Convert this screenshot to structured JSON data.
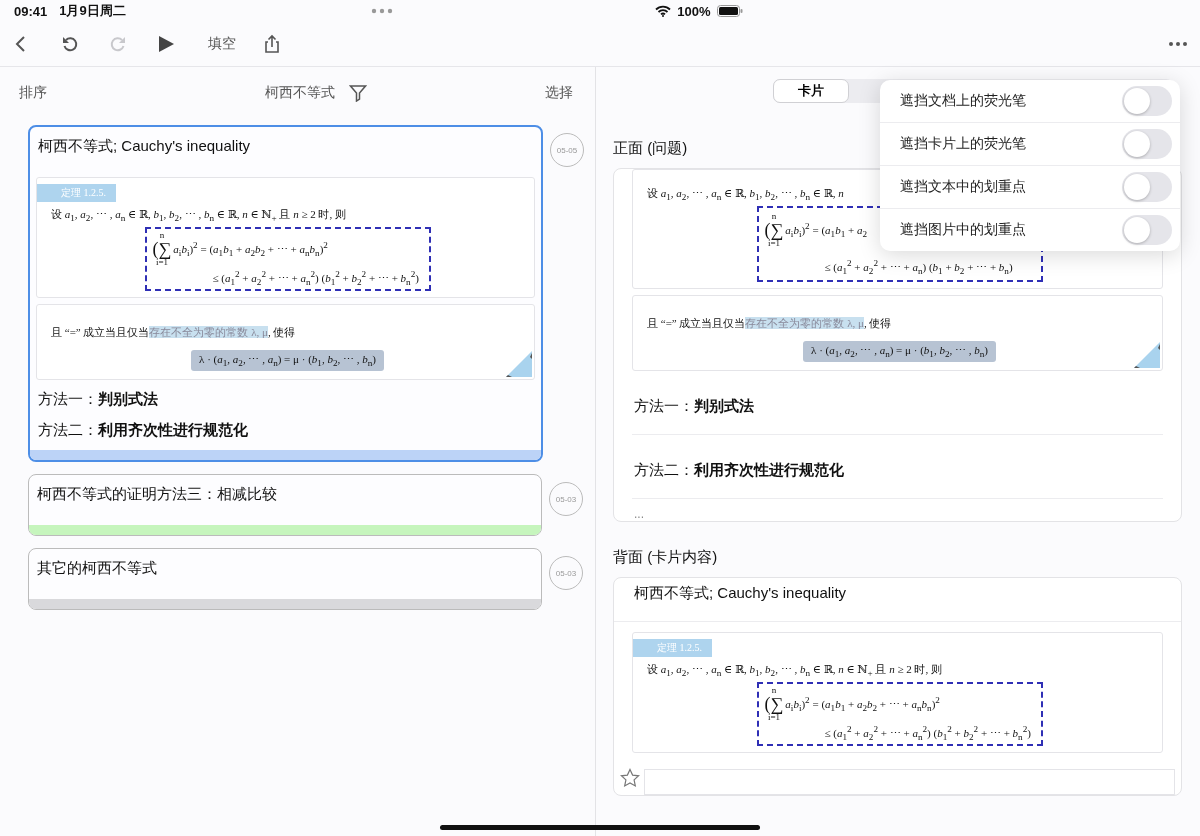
{
  "status_bar": {
    "time": "09:41",
    "date": "1月9日周二",
    "battery": "100%"
  },
  "toolbar": {
    "items": [
      {
        "kind": "back",
        "disabled": false
      },
      {
        "kind": "undo",
        "disabled": false
      },
      {
        "kind": "redo",
        "disabled": true
      },
      {
        "kind": "play",
        "disabled": false
      },
      {
        "kind": "text",
        "label": "填空",
        "disabled": false
      },
      {
        "kind": "share",
        "disabled": false
      }
    ]
  },
  "list_header": {
    "sort": "排序",
    "title": "柯西不等式",
    "select": "选择"
  },
  "cards": [
    {
      "title": "柯西不等式; Cauchy's inequality",
      "date": "05-05",
      "selected": true,
      "color": "#bcd3f7",
      "blocks": [
        {
          "kind": "theorem",
          "label": "定理 1.2.5.",
          "intro": "设 *a*$_{1}$, *a*$_{2}$, ⋯ , *a*$_{n}$ ∈ ℝ, *b*$_{1}$, *b*$_{2}$, ⋯ , *b*$_{n}$ ∈ ℝ, *n* ∈ ℕ$_{+}$ 且 *n* ≥ 2 时, 则",
          "sum_upper": "n",
          "sum_symbol": "(∑",
          "sum_lower": "i=1",
          "eq1": "*a*$_{i}$*b*$_{i}$)$^{2}$ = (*a*$_{1}$*b*$_{1}$ + *a*$_{2}$*b*$_{2}$ + ⋯ + *a*$_{n}$*b*$_{n}$)$^{2}$",
          "eq2": "≤ (*a*$_{1}$$^{2}$ + *a*$_{2}$$^{2}$ + ⋯ + *a*$_{n}$$^{2}$) (*b*$_{1}$$^{2}$ + *b*$_{2}$$^{2}$ + ⋯ + *b*$_{n}$$^{2}$)"
        },
        {
          "kind": "equality",
          "before": "且 “=” 成立当且仅当",
          "highlight": "存在不全为零的常数 λ, μ",
          "after": ", 使得",
          "formula": "λ · (*a*$_{1}$, *a*$_{2}$, ⋯ , *a*$_{n}$) = μ · (*b*$_{1}$, *b*$_{2}$, ⋯ , *b*$_{n}$)"
        },
        {
          "kind": "line",
          "text": "方法一：**判别式法**"
        },
        {
          "kind": "line",
          "text": "方法二：**利用齐次性进行规范化**"
        }
      ]
    },
    {
      "title": "柯西不等式的证明方法三：相减比较",
      "date": "05-03",
      "selected": false,
      "color": "#c6f5bd"
    },
    {
      "title": "其它的柯西不等式",
      "date": "05-03",
      "selected": false,
      "color": "#d9d9dc"
    }
  ],
  "segmented": {
    "segments": [
      {
        "label": "卡片",
        "selected": true
      }
    ]
  },
  "front": {
    "heading": "正面 (问题)",
    "blocks": [
      {
        "kind": "theorem",
        "intro": "设 *a*$_{1}$, *a*$_{2}$, ⋯ , *a*$_{n}$ ∈ ℝ, *b*$_{1}$, *b*$_{2}$, ⋯ , *b*$_{n}$ ∈ ℝ, *n*",
        "sum_upper": "n",
        "sum_symbol": "(∑",
        "sum_lower": "i=1",
        "eq1": "*a*$_{i}$*b*$_{i}$)$^{2}$ = (*a*$_{1}$*b*$_{1}$ + *a*$_{2}$",
        "eq2": "≤ (*a*$_{1}$$^{2}$ + *a*$_{2}$$^{2}$ + ⋯ + *a*$_{n}$) (*b*$_{1}$ + *b*$_{2}$ + ⋯ + *b*$_{n}$)"
      },
      {
        "kind": "equality",
        "before": "且 “=” 成立当且仅当",
        "highlight": "存在不全为零的常数 λ, μ",
        "after": ", 使得",
        "formula": "λ · (*a*$_{1}$, *a*$_{2}$, ⋯ , *a*$_{n}$) = μ · (*b*$_{1}$, *b*$_{2}$, ⋯ , *b*$_{n}$)"
      },
      {
        "kind": "line",
        "text": "方法一：**判别式法**"
      },
      {
        "kind": "line",
        "text": "方法二：**利用齐次性进行规范化**"
      },
      {
        "kind": "more",
        "text": "..."
      }
    ]
  },
  "back": {
    "heading": "背面 (卡片内容)",
    "title": "柯西不等式; Cauchy's inequality",
    "blocks": [
      {
        "kind": "theorem",
        "label": "定理 1.2.5.",
        "intro": "设 *a*$_{1}$, *a*$_{2}$, ⋯ , *a*$_{n}$ ∈ ℝ, *b*$_{1}$, *b*$_{2}$, ⋯ , *b*$_{n}$ ∈ ℝ, *n* ∈ ℕ$_{+}$ 且 *n* ≥ 2 时, 则",
        "sum_upper": "n",
        "sum_symbol": "(∑",
        "sum_lower": "i=1",
        "eq1": "*a*$_{i}$*b*$_{i}$)$^{2}$ = (*a*$_{1}$*b*$_{1}$ + *a*$_{2}$*b*$_{2}$ + ⋯ + *a*$_{n}$*b*$_{n}$)$^{2}$",
        "eq2": "≤ (*a*$_{1}$$^{2}$ + *a*$_{2}$$^{2}$ + ⋯ + *a*$_{n}$$^{2}$) (*b*$_{1}$$^{2}$ + *b*$_{2}$$^{2}$ + ⋯ + *b*$_{n}$$^{2}$)"
      }
    ]
  },
  "menu": {
    "items": [
      {
        "label": "遮挡文档上的荧光笔",
        "on": false
      },
      {
        "label": "遮挡卡片上的荧光笔",
        "on": false
      },
      {
        "label": "遮挡文本中的划重点",
        "on": false
      },
      {
        "label": "遮挡图片中的划重点",
        "on": false
      }
    ]
  }
}
